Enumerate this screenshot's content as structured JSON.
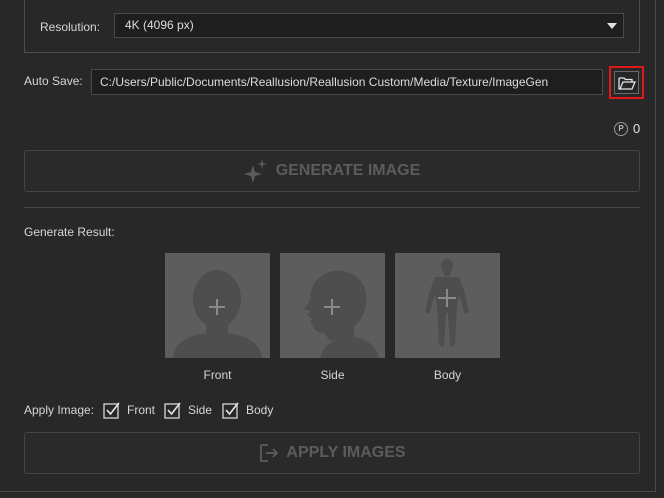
{
  "settings": {
    "resolution_label": "Resolution:",
    "resolution_value": "4K (4096 px)",
    "autosave_label": "Auto Save:",
    "autosave_path": "C:/Users/Public/Documents/Reallusion/Reallusion Custom/Media/Texture/ImageGen"
  },
  "points": {
    "value": "0",
    "icon_letter": "P"
  },
  "generate_button": {
    "label": "GENERATE IMAGE",
    "icon": "sparkle-icon"
  },
  "result": {
    "label": "Generate Result:",
    "thumbnails": [
      {
        "label": "Front",
        "icon": "front-head-silhouette-icon"
      },
      {
        "label": "Side",
        "icon": "side-head-silhouette-icon"
      },
      {
        "label": "Body",
        "icon": "body-silhouette-icon"
      }
    ]
  },
  "apply": {
    "label": "Apply Image:",
    "options": [
      {
        "label": "Front",
        "checked": true
      },
      {
        "label": "Side",
        "checked": true
      },
      {
        "label": "Body",
        "checked": true
      }
    ]
  },
  "apply_button": {
    "label": "APPLY IMAGES",
    "icon": "import-icon"
  },
  "colors": {
    "highlight": "#e01818",
    "background": "#282828",
    "thumbnail": "#5d5d5d"
  }
}
